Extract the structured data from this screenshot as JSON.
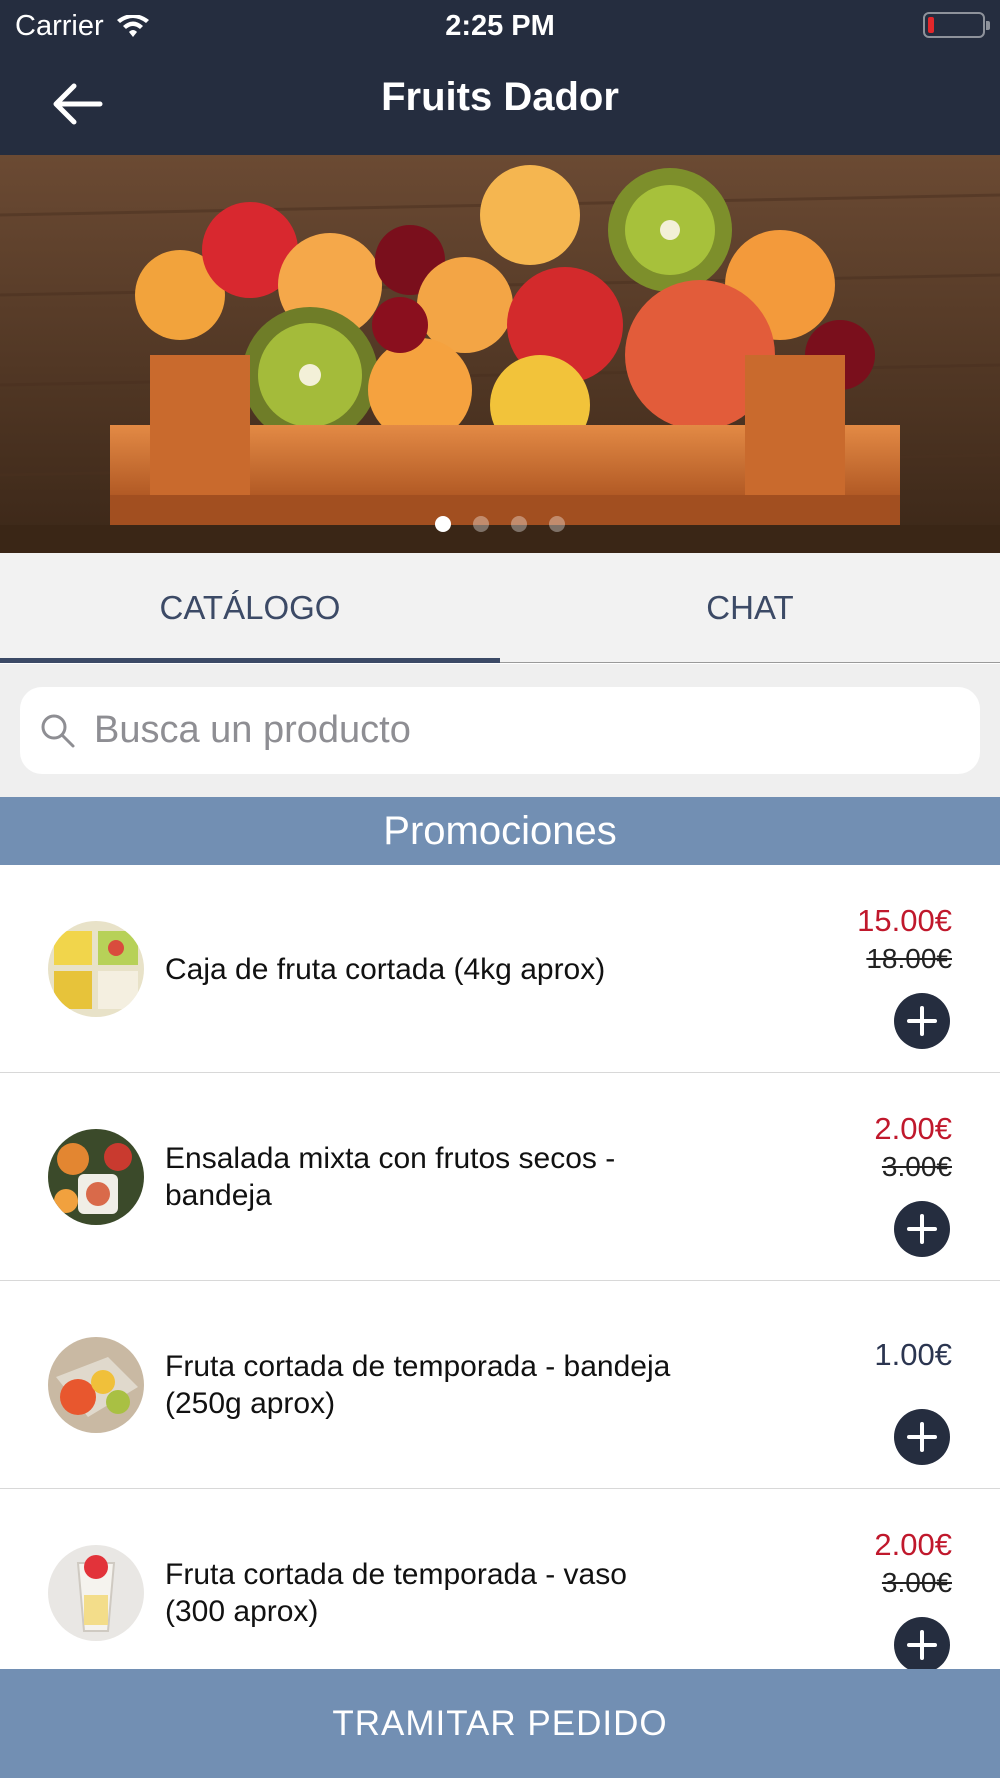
{
  "status": {
    "carrier": "Carrier",
    "time": "2:25 PM"
  },
  "header": {
    "title": "Fruits Dador"
  },
  "banner": {
    "pages": 4,
    "active_page": 1
  },
  "tabs": [
    {
      "label": "CATÁLOGO",
      "active": true
    },
    {
      "label": "CHAT",
      "active": false
    }
  ],
  "search": {
    "placeholder": "Busca un producto",
    "value": ""
  },
  "section": {
    "title": "Promociones"
  },
  "products": [
    {
      "name": "Caja de fruta cortada (4kg aprox)",
      "price": "15.00€",
      "old_price": "18.00€"
    },
    {
      "name": "Ensalada mixta con frutos secos - bandeja",
      "price": "2.00€",
      "old_price": "3.00€"
    },
    {
      "name": "Fruta cortada de temporada - bandeja (250g aprox)",
      "price": "1.00€",
      "old_price": ""
    },
    {
      "name": "Fruta cortada de temporada - vaso (300 aprox)",
      "price": "2.00€",
      "old_price": "3.00€"
    }
  ],
  "footer": {
    "checkout_label": "TRAMITAR PEDIDO"
  },
  "colors": {
    "nav": "#252d3f",
    "accent": "#728fb3",
    "promo_price": "#c0182c"
  }
}
